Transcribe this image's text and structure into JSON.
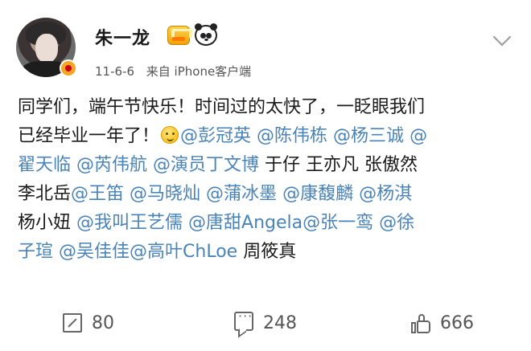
{
  "post": {
    "username": "朱一龙",
    "time": "11-6-6",
    "source": "来自 iPhone客户端",
    "lines": [
      [
        {
          "t": "text",
          "v": "同学们，端午节快乐！时间过的太快了，一眨眼我们"
        }
      ],
      [
        {
          "t": "text",
          "v": "已经毕业一年了！"
        },
        {
          "t": "emoji",
          "v": "smile-emoji"
        },
        {
          "t": "mention",
          "v": "@彭冠英"
        },
        {
          "t": "text",
          "v": " "
        },
        {
          "t": "mention",
          "v": "@陈伟栋"
        },
        {
          "t": "text",
          "v": " "
        },
        {
          "t": "mention",
          "v": "@杨三诚"
        },
        {
          "t": "text",
          "v": " "
        },
        {
          "t": "mention",
          "v": "@"
        }
      ],
      [
        {
          "t": "mention",
          "v": "翟天临"
        },
        {
          "t": "text",
          "v": " "
        },
        {
          "t": "mention",
          "v": "@芮伟航"
        },
        {
          "t": "text",
          "v": " "
        },
        {
          "t": "mention",
          "v": "@演员丁文博"
        },
        {
          "t": "text",
          "v": " 于仔 王亦凡 张傲然"
        }
      ],
      [
        {
          "t": "text",
          "v": "李北岳"
        },
        {
          "t": "mention",
          "v": "@王笛"
        },
        {
          "t": "text",
          "v": " "
        },
        {
          "t": "mention",
          "v": "@马晓灿"
        },
        {
          "t": "text",
          "v": " "
        },
        {
          "t": "mention",
          "v": "@蒲冰墨"
        },
        {
          "t": "text",
          "v": " "
        },
        {
          "t": "mention",
          "v": "@康馥麟"
        },
        {
          "t": "text",
          "v": " "
        },
        {
          "t": "mention",
          "v": "@杨淇"
        }
      ],
      [
        {
          "t": "text",
          "v": "杨小妞 "
        },
        {
          "t": "mention",
          "v": "@我叫王艺儒"
        },
        {
          "t": "text",
          "v": " "
        },
        {
          "t": "mention",
          "v": "@唐甜Angela"
        },
        {
          "t": "mention",
          "v": "@张一鸾"
        },
        {
          "t": "text",
          "v": " "
        },
        {
          "t": "mention",
          "v": "@徐"
        }
      ],
      [
        {
          "t": "mention",
          "v": "子瑄"
        },
        {
          "t": "text",
          "v": " "
        },
        {
          "t": "mention",
          "v": "@吴佳佳"
        },
        {
          "t": "mention",
          "v": "@高叶ChLoe"
        },
        {
          "t": "text",
          "v": " 周筱真"
        }
      ]
    ]
  },
  "actions": {
    "repost_count": "80",
    "comment_count": "248",
    "like_count": "666"
  },
  "colors": {
    "mention": "#4a83b8",
    "text": "#1a1a1a",
    "meta": "#555555",
    "verified": "#f5a623"
  }
}
